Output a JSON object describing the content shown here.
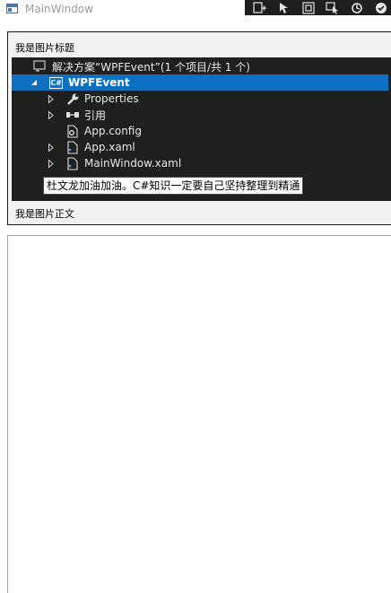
{
  "window": {
    "title": "MainWindow"
  },
  "image_block": {
    "heading": "我是图片标题",
    "caption": "我是图片正文"
  },
  "solution_explorer": {
    "solution_label": "解决方案“WPFEvent”(1 个项目/共 1 个)",
    "project_badge": "C#",
    "project_label": "WPFEvent",
    "items": [
      {
        "label": "Properties",
        "icon": "wrench-icon"
      },
      {
        "label": "引用",
        "icon": "references-icon"
      },
      {
        "label": "App.config",
        "icon": "config-file-icon"
      },
      {
        "label": "App.xaml",
        "icon": "xaml-file-icon"
      },
      {
        "label": "MainWindow.xaml",
        "icon": "xaml-file-icon"
      }
    ]
  },
  "tooltip": {
    "text": "杜文龙加油加油。C#知识一定要自己坚持整理到精通"
  },
  "colors": {
    "tree_background": "#1f1f1f",
    "selection": "#0e70c0",
    "toolbar_background": "#1e1e1e"
  }
}
